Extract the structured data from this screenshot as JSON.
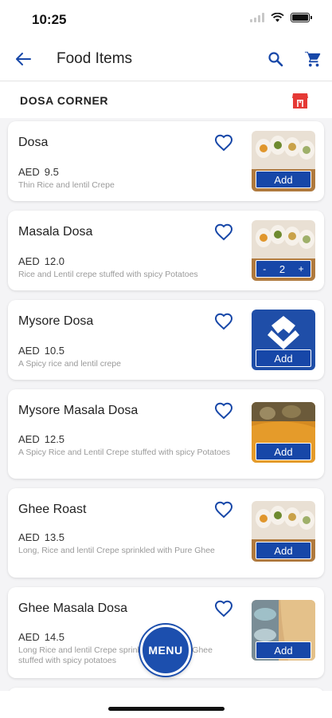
{
  "status": {
    "time": "10:25"
  },
  "appbar": {
    "title": "Food Items"
  },
  "section": {
    "name": "DOSA CORNER"
  },
  "colors": {
    "primary": "#1747a8",
    "shop_icon": "#e53935",
    "description": "#9a9a9a"
  },
  "icons": {
    "back": "arrow-left-icon",
    "search": "search-icon",
    "cart": "cart-icon",
    "favorite": "heart-outline-icon",
    "shop": "shop-icon"
  },
  "items": [
    {
      "name": "Dosa",
      "currency": "AED",
      "price": "9.5",
      "description": "Thin Rice and lentil Crepe",
      "action": "Add",
      "image": "spoons"
    },
    {
      "name": "Masala Dosa",
      "currency": "AED",
      "price": "12.0",
      "description": "Rice and Lentil crepe stuffed with spicy Potatoes",
      "image": "spoons",
      "stepper": {
        "minus": "-",
        "qty": "2",
        "plus": "+"
      }
    },
    {
      "name": "Mysore Dosa",
      "currency": "AED",
      "price": "10.5",
      "description": "A Spicy rice and lentil crepe",
      "action": "Add",
      "image": "logo"
    },
    {
      "name": "Mysore Masala Dosa",
      "currency": "AED",
      "price": "12.5",
      "description": "A Spicy Rice and Lentil Crepe stuffed with spicy Potatoes",
      "action": "Add",
      "image": "dosa"
    },
    {
      "name": "Ghee Roast",
      "currency": "AED",
      "price": "13.5",
      "description": "Long, Rice and lentil Crepe sprinkled with Pure Ghee",
      "action": "Add",
      "image": "spoons"
    },
    {
      "name": "Ghee Masala Dosa",
      "currency": "AED",
      "price": "14.5",
      "description": "Long Rice and lentil Crepe sprinkled with Pure Ghee stuffed with spicy potatoes",
      "action": "Add",
      "image": "bowls"
    }
  ],
  "fab": {
    "label": "MENU"
  }
}
